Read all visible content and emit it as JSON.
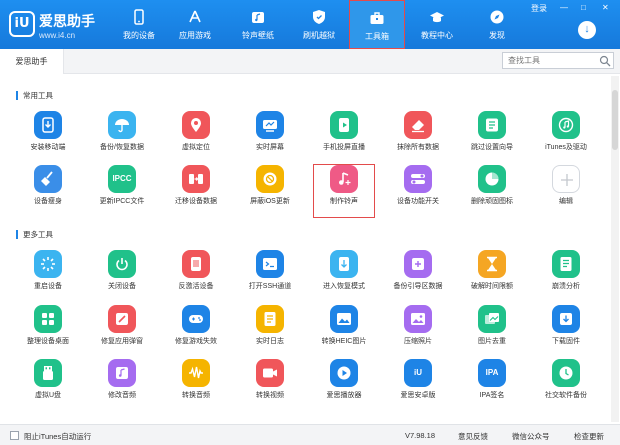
{
  "app": {
    "name": "爱思助手",
    "url": "www.i4.cn",
    "logo_mark": "iU"
  },
  "header": {
    "window_controls": [
      "登录",
      "—",
      "□",
      "✕"
    ],
    "download_icon": "download-icon",
    "nav": [
      {
        "label": "我的设备",
        "icon": "phone-icon"
      },
      {
        "label": "应用游戏",
        "icon": "appstore-icon"
      },
      {
        "label": "铃声壁纸",
        "icon": "music-icon"
      },
      {
        "label": "刷机越狱",
        "icon": "shield-icon"
      },
      {
        "label": "工具箱",
        "icon": "toolbox-icon",
        "active": true
      },
      {
        "label": "教程中心",
        "icon": "graduation-icon"
      },
      {
        "label": "发现",
        "icon": "compass-icon"
      }
    ]
  },
  "tabbar": {
    "tab": "爱思助手",
    "search_placeholder": "查找工具"
  },
  "sections": {
    "common": {
      "title": "常用工具",
      "tools": [
        {
          "label": "安装移动端",
          "color": "#1e84e6",
          "icon": "install-icon"
        },
        {
          "label": "备份/恢复数据",
          "color": "#3bb4f0",
          "icon": "umbrella-icon"
        },
        {
          "label": "虚拟定位",
          "color": "#f0565a",
          "icon": "location-icon"
        },
        {
          "label": "实时屏幕",
          "color": "#1e84e6",
          "icon": "screen-icon"
        },
        {
          "label": "手机投屏直播",
          "color": "#20c18a",
          "icon": "cast-icon"
        },
        {
          "label": "抹除所有数据",
          "color": "#f0565a",
          "icon": "eraser-icon"
        },
        {
          "label": "跳过设置向导",
          "color": "#20c18a",
          "icon": "skip-icon"
        },
        {
          "label": "iTunes及驱动",
          "color": "#20c18a",
          "icon": "itunes-icon"
        },
        {
          "label": "设备瘦身",
          "color": "#3a8ee8",
          "icon": "broom-icon"
        },
        {
          "label": "更新IPCC文件",
          "color": "#20c18a",
          "icon": "ipcc-icon",
          "glyph": "IPCC"
        },
        {
          "label": "迁移设备数据",
          "color": "#f0565a",
          "icon": "migrate-icon"
        },
        {
          "label": "屏蔽iOS更新",
          "color": "#f5b400",
          "icon": "block-update-icon"
        },
        {
          "label": "制作铃声",
          "color": "#ef5a86",
          "icon": "ringtone-icon",
          "highlight": true
        },
        {
          "label": "设备功能开关",
          "color": "#a56cf0",
          "icon": "toggle-icon"
        },
        {
          "label": "删除顽固图标",
          "color": "#20c18a",
          "icon": "delete-icon-icon"
        },
        {
          "label": "编辑",
          "color": "#ffffff",
          "icon": "plus-icon"
        }
      ]
    },
    "more": {
      "title": "更多工具",
      "tools": [
        {
          "label": "重启设备",
          "color": "#3bb4f0",
          "icon": "restart-icon"
        },
        {
          "label": "关闭设备",
          "color": "#20c18a",
          "icon": "power-icon"
        },
        {
          "label": "反激活设备",
          "color": "#f0565a",
          "icon": "deactivate-icon"
        },
        {
          "label": "打开SSH通道",
          "color": "#1e84e6",
          "icon": "terminal-icon"
        },
        {
          "label": "进入恢复模式",
          "color": "#3bb4f0",
          "icon": "recovery-icon"
        },
        {
          "label": "备份引导区数据",
          "color": "#a56cf0",
          "icon": "backup-boot-icon"
        },
        {
          "label": "破解时间限额",
          "color": "#f5a623",
          "icon": "hourglass-icon"
        },
        {
          "label": "崩溃分析",
          "color": "#20c18a",
          "icon": "crash-icon"
        },
        {
          "label": "整理设备桌面",
          "color": "#20c18a",
          "icon": "grid-icon"
        },
        {
          "label": "修复应用弹窗",
          "color": "#f0565a",
          "icon": "repair-icon"
        },
        {
          "label": "修复游戏失效",
          "color": "#1e84e6",
          "icon": "gamepad-icon"
        },
        {
          "label": "实时日志",
          "color": "#f5b400",
          "icon": "log-icon"
        },
        {
          "label": "转换HEIC图片",
          "color": "#1e84e6",
          "icon": "heic-icon"
        },
        {
          "label": "压缩照片",
          "color": "#a56cf0",
          "icon": "compress-icon"
        },
        {
          "label": "图片去重",
          "color": "#20c18a",
          "icon": "dedupe-icon"
        },
        {
          "label": "下载固件",
          "color": "#1e84e6",
          "icon": "firmware-icon"
        },
        {
          "label": "虚拟U盘",
          "color": "#20c18a",
          "icon": "usb-icon"
        },
        {
          "label": "修改音频",
          "color": "#a56cf0",
          "icon": "audio-edit-icon"
        },
        {
          "label": "转换音频",
          "color": "#f5b400",
          "icon": "audio-wave-icon"
        },
        {
          "label": "转换视频",
          "color": "#f0565a",
          "icon": "video-icon"
        },
        {
          "label": "爱思播放器",
          "color": "#1e84e6",
          "icon": "player-icon"
        },
        {
          "label": "爱思安卓版",
          "color": "#1e84e6",
          "icon": "android-icon",
          "glyph": "iU"
        },
        {
          "label": "IPA签名",
          "color": "#1e84e6",
          "icon": "ipa-icon",
          "glyph": "IPA"
        },
        {
          "label": "社交软件备份",
          "color": "#20c18a",
          "icon": "social-backup-icon"
        }
      ]
    }
  },
  "statusbar": {
    "checkbox_label": "阻止iTunes自动运行",
    "version": "V7.98.18",
    "feedback": "意见反馈",
    "wechat": "微信公众号",
    "update": "检查更新"
  }
}
